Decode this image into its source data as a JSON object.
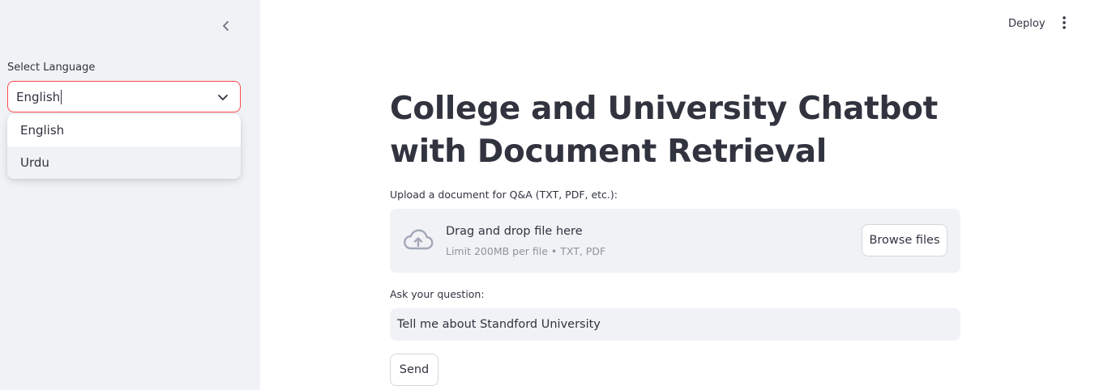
{
  "sidebar": {
    "select": {
      "label": "Select Language",
      "value": "English",
      "options": [
        "English",
        "Urdu"
      ],
      "highlighted_option": "Urdu"
    },
    "collapse_icon": "chevron-left-icon"
  },
  "header": {
    "deploy_label": "Deploy",
    "menu_icon": "vertical-dots-icon"
  },
  "main": {
    "title": "College and University Chatbot with Document Retrieval",
    "upload": {
      "label": "Upload a document for Q&A (TXT, PDF, etc.):",
      "dropzone_text": "Drag and drop file here",
      "dropzone_limit": "Limit 200MB per file • TXT, PDF",
      "browse_label": "Browse files",
      "icon": "cloud-upload-icon"
    },
    "question": {
      "label": "Ask your question:",
      "value": "Tell me about Standford University"
    },
    "send_label": "Send"
  },
  "colors": {
    "sidebar_bg": "#f0f2f6",
    "focus_border": "#ff4b4b",
    "text": "#31333f",
    "muted_text": "#8f939c"
  }
}
